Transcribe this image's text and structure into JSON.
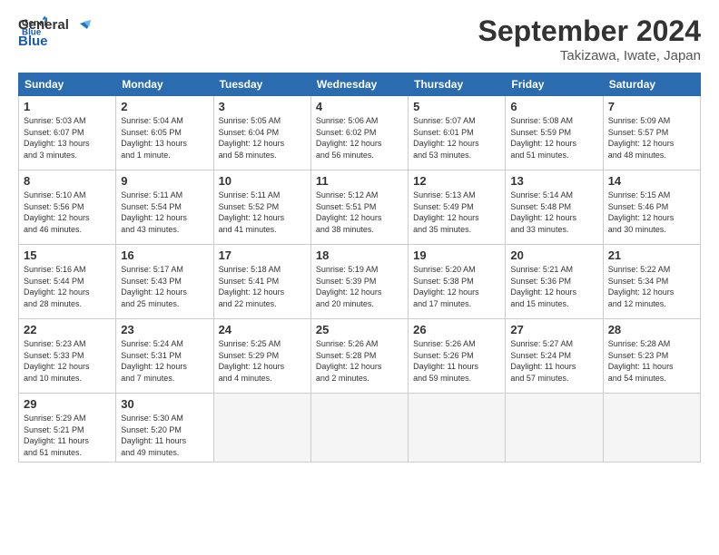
{
  "logo": {
    "line1": "General",
    "line2": "Blue"
  },
  "title": "September 2024",
  "location": "Takizawa, Iwate, Japan",
  "weekdays": [
    "Sunday",
    "Monday",
    "Tuesday",
    "Wednesday",
    "Thursday",
    "Friday",
    "Saturday"
  ],
  "weeks": [
    [
      {
        "day": "1",
        "info": "Sunrise: 5:03 AM\nSunset: 6:07 PM\nDaylight: 13 hours\nand 3 minutes."
      },
      {
        "day": "2",
        "info": "Sunrise: 5:04 AM\nSunset: 6:05 PM\nDaylight: 13 hours\nand 1 minute."
      },
      {
        "day": "3",
        "info": "Sunrise: 5:05 AM\nSunset: 6:04 PM\nDaylight: 12 hours\nand 58 minutes."
      },
      {
        "day": "4",
        "info": "Sunrise: 5:06 AM\nSunset: 6:02 PM\nDaylight: 12 hours\nand 56 minutes."
      },
      {
        "day": "5",
        "info": "Sunrise: 5:07 AM\nSunset: 6:01 PM\nDaylight: 12 hours\nand 53 minutes."
      },
      {
        "day": "6",
        "info": "Sunrise: 5:08 AM\nSunset: 5:59 PM\nDaylight: 12 hours\nand 51 minutes."
      },
      {
        "day": "7",
        "info": "Sunrise: 5:09 AM\nSunset: 5:57 PM\nDaylight: 12 hours\nand 48 minutes."
      }
    ],
    [
      {
        "day": "8",
        "info": "Sunrise: 5:10 AM\nSunset: 5:56 PM\nDaylight: 12 hours\nand 46 minutes."
      },
      {
        "day": "9",
        "info": "Sunrise: 5:11 AM\nSunset: 5:54 PM\nDaylight: 12 hours\nand 43 minutes."
      },
      {
        "day": "10",
        "info": "Sunrise: 5:11 AM\nSunset: 5:52 PM\nDaylight: 12 hours\nand 41 minutes."
      },
      {
        "day": "11",
        "info": "Sunrise: 5:12 AM\nSunset: 5:51 PM\nDaylight: 12 hours\nand 38 minutes."
      },
      {
        "day": "12",
        "info": "Sunrise: 5:13 AM\nSunset: 5:49 PM\nDaylight: 12 hours\nand 35 minutes."
      },
      {
        "day": "13",
        "info": "Sunrise: 5:14 AM\nSunset: 5:48 PM\nDaylight: 12 hours\nand 33 minutes."
      },
      {
        "day": "14",
        "info": "Sunrise: 5:15 AM\nSunset: 5:46 PM\nDaylight: 12 hours\nand 30 minutes."
      }
    ],
    [
      {
        "day": "15",
        "info": "Sunrise: 5:16 AM\nSunset: 5:44 PM\nDaylight: 12 hours\nand 28 minutes."
      },
      {
        "day": "16",
        "info": "Sunrise: 5:17 AM\nSunset: 5:43 PM\nDaylight: 12 hours\nand 25 minutes."
      },
      {
        "day": "17",
        "info": "Sunrise: 5:18 AM\nSunset: 5:41 PM\nDaylight: 12 hours\nand 22 minutes."
      },
      {
        "day": "18",
        "info": "Sunrise: 5:19 AM\nSunset: 5:39 PM\nDaylight: 12 hours\nand 20 minutes."
      },
      {
        "day": "19",
        "info": "Sunrise: 5:20 AM\nSunset: 5:38 PM\nDaylight: 12 hours\nand 17 minutes."
      },
      {
        "day": "20",
        "info": "Sunrise: 5:21 AM\nSunset: 5:36 PM\nDaylight: 12 hours\nand 15 minutes."
      },
      {
        "day": "21",
        "info": "Sunrise: 5:22 AM\nSunset: 5:34 PM\nDaylight: 12 hours\nand 12 minutes."
      }
    ],
    [
      {
        "day": "22",
        "info": "Sunrise: 5:23 AM\nSunset: 5:33 PM\nDaylight: 12 hours\nand 10 minutes."
      },
      {
        "day": "23",
        "info": "Sunrise: 5:24 AM\nSunset: 5:31 PM\nDaylight: 12 hours\nand 7 minutes."
      },
      {
        "day": "24",
        "info": "Sunrise: 5:25 AM\nSunset: 5:29 PM\nDaylight: 12 hours\nand 4 minutes."
      },
      {
        "day": "25",
        "info": "Sunrise: 5:26 AM\nSunset: 5:28 PM\nDaylight: 12 hours\nand 2 minutes."
      },
      {
        "day": "26",
        "info": "Sunrise: 5:26 AM\nSunset: 5:26 PM\nDaylight: 11 hours\nand 59 minutes."
      },
      {
        "day": "27",
        "info": "Sunrise: 5:27 AM\nSunset: 5:24 PM\nDaylight: 11 hours\nand 57 minutes."
      },
      {
        "day": "28",
        "info": "Sunrise: 5:28 AM\nSunset: 5:23 PM\nDaylight: 11 hours\nand 54 minutes."
      }
    ],
    [
      {
        "day": "29",
        "info": "Sunrise: 5:29 AM\nSunset: 5:21 PM\nDaylight: 11 hours\nand 51 minutes."
      },
      {
        "day": "30",
        "info": "Sunrise: 5:30 AM\nSunset: 5:20 PM\nDaylight: 11 hours\nand 49 minutes."
      },
      {
        "day": "",
        "info": ""
      },
      {
        "day": "",
        "info": ""
      },
      {
        "day": "",
        "info": ""
      },
      {
        "day": "",
        "info": ""
      },
      {
        "day": "",
        "info": ""
      }
    ]
  ]
}
